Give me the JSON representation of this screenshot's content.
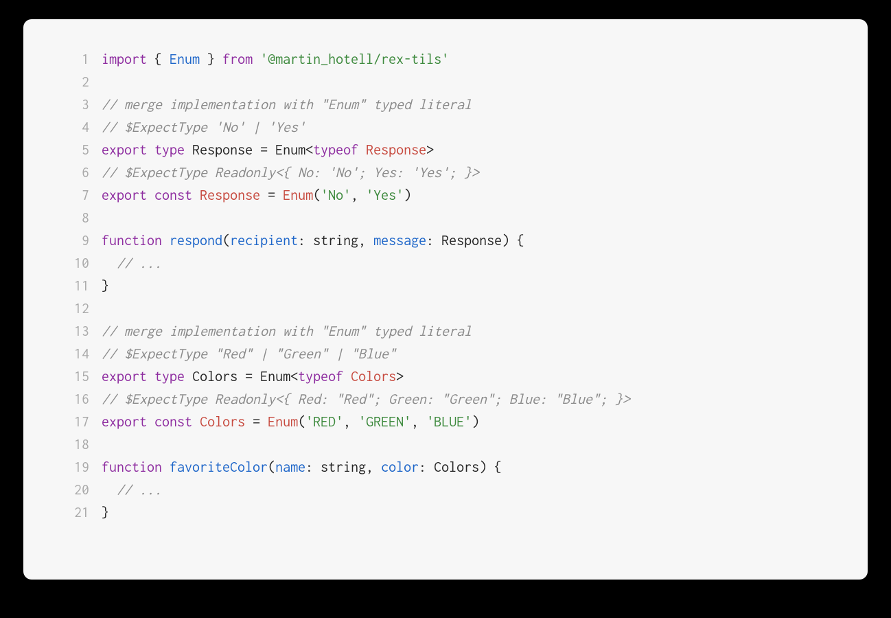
{
  "lines": [
    {
      "n": "1",
      "tokens": [
        {
          "t": "import",
          "c": "kw"
        },
        {
          "t": " { ",
          "c": "txt"
        },
        {
          "t": "Enum",
          "c": "cls"
        },
        {
          "t": " } ",
          "c": "txt"
        },
        {
          "t": "from",
          "c": "kw"
        },
        {
          "t": " ",
          "c": "txt"
        },
        {
          "t": "'@martin_hotell/rex-tils'",
          "c": "str"
        }
      ]
    },
    {
      "n": "2",
      "tokens": []
    },
    {
      "n": "3",
      "tokens": [
        {
          "t": "// merge implementation with \"Enum\" typed literal",
          "c": "com"
        }
      ]
    },
    {
      "n": "4",
      "tokens": [
        {
          "t": "// $ExpectType 'No' | 'Yes'",
          "c": "com"
        }
      ]
    },
    {
      "n": "5",
      "tokens": [
        {
          "t": "export",
          "c": "kw"
        },
        {
          "t": " ",
          "c": "txt"
        },
        {
          "t": "type",
          "c": "kw"
        },
        {
          "t": " ",
          "c": "txt"
        },
        {
          "t": "Response",
          "c": "txt"
        },
        {
          "t": " = ",
          "c": "txt"
        },
        {
          "t": "Enum",
          "c": "txt"
        },
        {
          "t": "<",
          "c": "txt"
        },
        {
          "t": "typeof",
          "c": "kw"
        },
        {
          "t": " ",
          "c": "txt"
        },
        {
          "t": "Response",
          "c": "ident"
        },
        {
          "t": ">",
          "c": "txt"
        }
      ]
    },
    {
      "n": "6",
      "tokens": [
        {
          "t": "// $ExpectType Readonly<{ No: 'No'; Yes: 'Yes'; }>",
          "c": "com"
        }
      ]
    },
    {
      "n": "7",
      "tokens": [
        {
          "t": "export",
          "c": "kw"
        },
        {
          "t": " ",
          "c": "txt"
        },
        {
          "t": "const",
          "c": "kw"
        },
        {
          "t": " ",
          "c": "txt"
        },
        {
          "t": "Response",
          "c": "ident"
        },
        {
          "t": " = ",
          "c": "txt"
        },
        {
          "t": "Enum",
          "c": "ident"
        },
        {
          "t": "(",
          "c": "txt"
        },
        {
          "t": "'No'",
          "c": "str"
        },
        {
          "t": ", ",
          "c": "txt"
        },
        {
          "t": "'Yes'",
          "c": "str"
        },
        {
          "t": ")",
          "c": "txt"
        }
      ]
    },
    {
      "n": "8",
      "tokens": []
    },
    {
      "n": "9",
      "tokens": [
        {
          "t": "function",
          "c": "kw"
        },
        {
          "t": " ",
          "c": "txt"
        },
        {
          "t": "respond",
          "c": "cls"
        },
        {
          "t": "(",
          "c": "txt"
        },
        {
          "t": "recipient",
          "c": "cls"
        },
        {
          "t": ": ",
          "c": "txt"
        },
        {
          "t": "string",
          "c": "txt"
        },
        {
          "t": ", ",
          "c": "txt"
        },
        {
          "t": "message",
          "c": "cls"
        },
        {
          "t": ": ",
          "c": "txt"
        },
        {
          "t": "Response",
          "c": "txt"
        },
        {
          "t": ") {",
          "c": "txt"
        }
      ]
    },
    {
      "n": "10",
      "tokens": [
        {
          "t": "  ",
          "c": "txt"
        },
        {
          "t": "// ...",
          "c": "com"
        }
      ]
    },
    {
      "n": "11",
      "tokens": [
        {
          "t": "}",
          "c": "txt"
        }
      ]
    },
    {
      "n": "12",
      "tokens": []
    },
    {
      "n": "13",
      "tokens": [
        {
          "t": "// merge implementation with \"Enum\" typed literal",
          "c": "com"
        }
      ]
    },
    {
      "n": "14",
      "tokens": [
        {
          "t": "// $ExpectType \"Red\" | \"Green\" | \"Blue\"",
          "c": "com"
        }
      ]
    },
    {
      "n": "15",
      "tokens": [
        {
          "t": "export",
          "c": "kw"
        },
        {
          "t": " ",
          "c": "txt"
        },
        {
          "t": "type",
          "c": "kw"
        },
        {
          "t": " ",
          "c": "txt"
        },
        {
          "t": "Colors",
          "c": "txt"
        },
        {
          "t": " = ",
          "c": "txt"
        },
        {
          "t": "Enum",
          "c": "txt"
        },
        {
          "t": "<",
          "c": "txt"
        },
        {
          "t": "typeof",
          "c": "kw"
        },
        {
          "t": " ",
          "c": "txt"
        },
        {
          "t": "Colors",
          "c": "ident"
        },
        {
          "t": ">",
          "c": "txt"
        }
      ]
    },
    {
      "n": "16",
      "tokens": [
        {
          "t": "// $ExpectType Readonly<{ Red: \"Red\"; Green: \"Green\"; Blue: \"Blue\"; }>",
          "c": "com"
        }
      ]
    },
    {
      "n": "17",
      "tokens": [
        {
          "t": "export",
          "c": "kw"
        },
        {
          "t": " ",
          "c": "txt"
        },
        {
          "t": "const",
          "c": "kw"
        },
        {
          "t": " ",
          "c": "txt"
        },
        {
          "t": "Colors",
          "c": "ident"
        },
        {
          "t": " = ",
          "c": "txt"
        },
        {
          "t": "Enum",
          "c": "ident"
        },
        {
          "t": "(",
          "c": "txt"
        },
        {
          "t": "'RED'",
          "c": "str"
        },
        {
          "t": ", ",
          "c": "txt"
        },
        {
          "t": "'GREEN'",
          "c": "str"
        },
        {
          "t": ", ",
          "c": "txt"
        },
        {
          "t": "'BLUE'",
          "c": "str"
        },
        {
          "t": ")",
          "c": "txt"
        }
      ]
    },
    {
      "n": "18",
      "tokens": []
    },
    {
      "n": "19",
      "tokens": [
        {
          "t": "function",
          "c": "kw"
        },
        {
          "t": " ",
          "c": "txt"
        },
        {
          "t": "favoriteColor",
          "c": "cls"
        },
        {
          "t": "(",
          "c": "txt"
        },
        {
          "t": "name",
          "c": "cls"
        },
        {
          "t": ": ",
          "c": "txt"
        },
        {
          "t": "string",
          "c": "txt"
        },
        {
          "t": ", ",
          "c": "txt"
        },
        {
          "t": "color",
          "c": "cls"
        },
        {
          "t": ": ",
          "c": "txt"
        },
        {
          "t": "Colors",
          "c": "txt"
        },
        {
          "t": ") {",
          "c": "txt"
        }
      ]
    },
    {
      "n": "20",
      "tokens": [
        {
          "t": "  ",
          "c": "txt"
        },
        {
          "t": "// ...",
          "c": "com"
        }
      ]
    },
    {
      "n": "21",
      "tokens": [
        {
          "t": "}",
          "c": "txt"
        }
      ]
    }
  ]
}
